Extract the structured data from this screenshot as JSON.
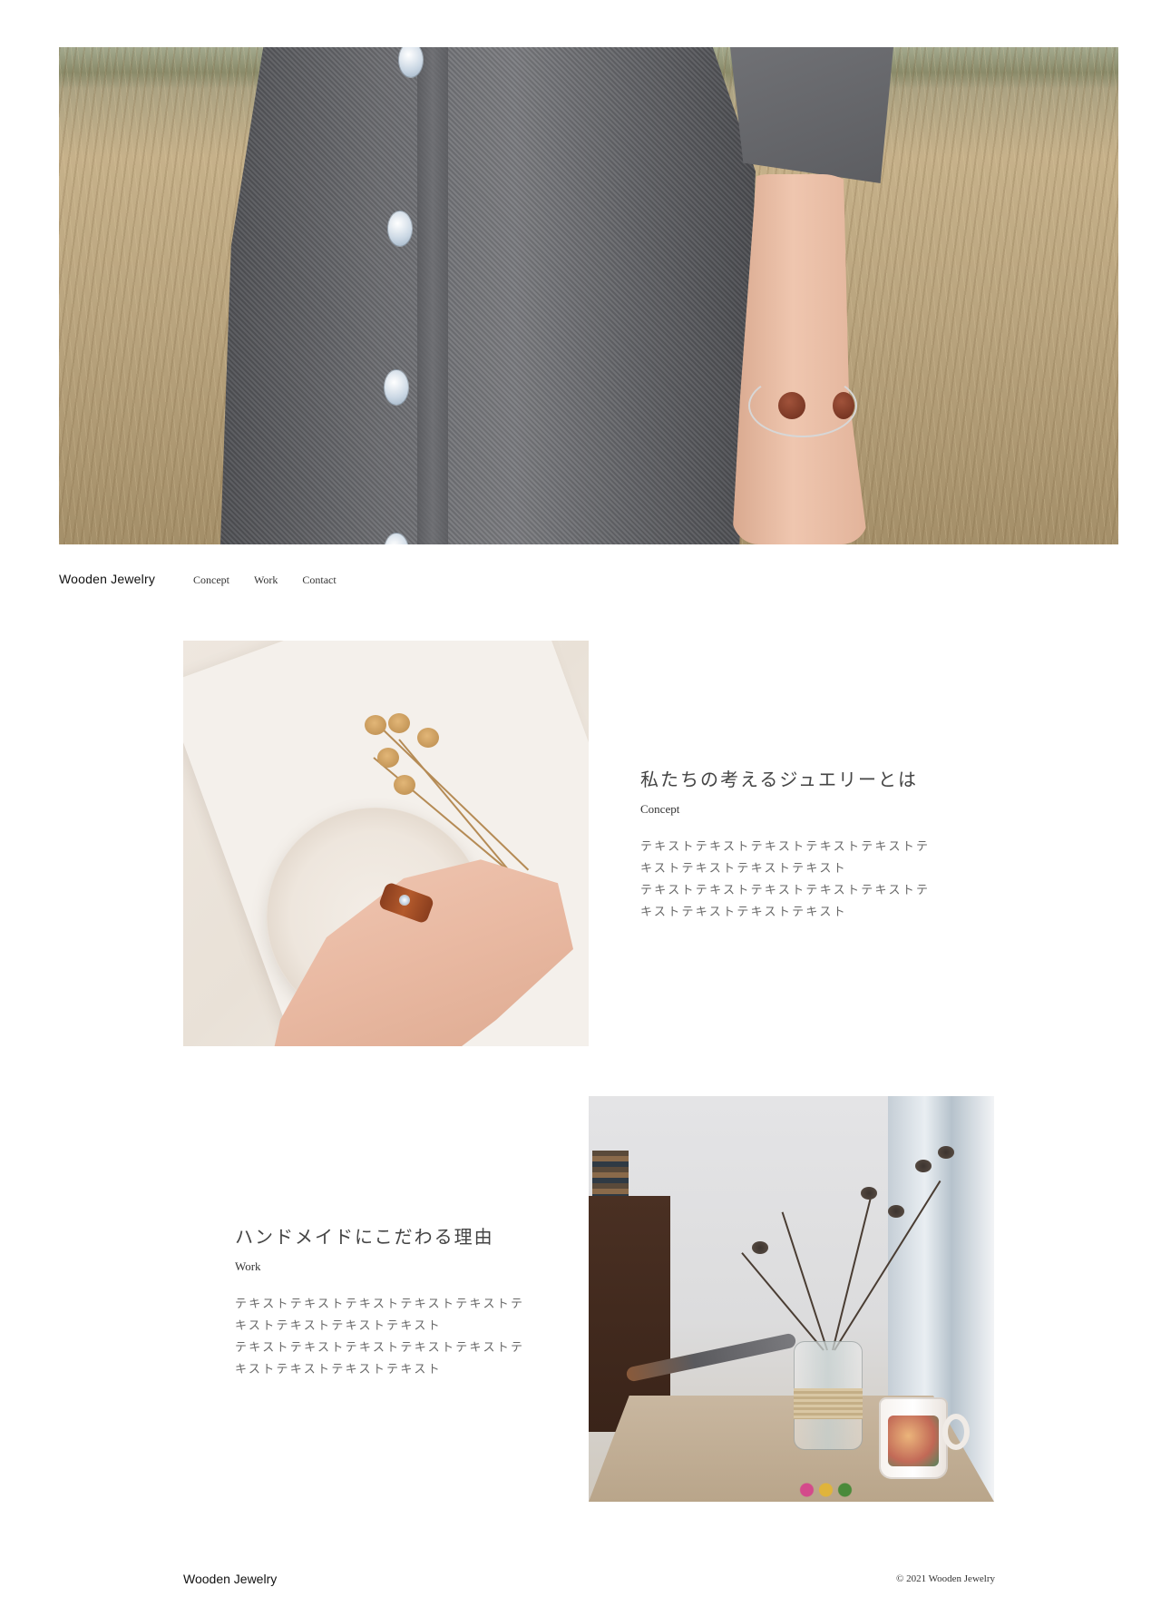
{
  "colors": {
    "background": "#ffffff",
    "text_primary": "#111111",
    "text_heading": "#444444",
    "text_body": "#666666"
  },
  "hero": {
    "image_icon": "hero-photo-dress-bracelet"
  },
  "header": {
    "brand": "Wooden Jewelry",
    "nav": [
      {
        "label": "Concept"
      },
      {
        "label": "Work"
      },
      {
        "label": "Contact"
      }
    ]
  },
  "concept": {
    "image_icon": "ring-photo",
    "title": "私たちの考えるジュエリーとは",
    "subtitle": "Concept",
    "paragraphs": [
      "テキストテキストテキストテキストテキストテキストテキストテキストテキスト",
      "テキストテキストテキストテキストテキストテキストテキストテキストテキスト"
    ]
  },
  "work": {
    "image_icon": "workshop-photo",
    "title": "ハンドメイドにこだわる理由",
    "subtitle": "Work",
    "paragraphs": [
      "テキストテキストテキストテキストテキストテキストテキストテキストテキスト",
      "テキストテキストテキストテキストテキストテキストテキストテキストテキスト"
    ]
  },
  "footer": {
    "brand": "Wooden Jewelry",
    "copyright": "© 2021 Wooden Jewelry"
  }
}
